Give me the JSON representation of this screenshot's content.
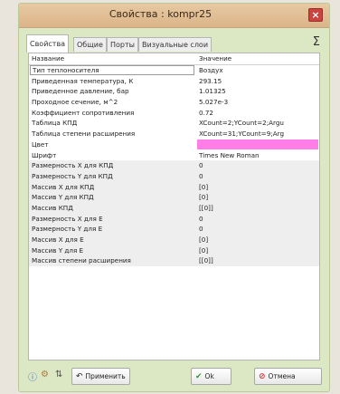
{
  "window": {
    "title": "Свойства : kompr25",
    "close_label": "×"
  },
  "tabs": [
    {
      "label": "Свойства",
      "active": true
    },
    {
      "label": "Общие",
      "active": false
    },
    {
      "label": "Порты",
      "active": false
    },
    {
      "label": "Визуальные слои",
      "active": false
    }
  ],
  "sigma_label": "Σ",
  "grid": {
    "headers": {
      "name": "Название",
      "value": "Значение"
    },
    "rows": [
      {
        "name": "Тип теплоносителя",
        "value": "Воздух"
      },
      {
        "name": "Приведенная температура, К",
        "value": "293.15"
      },
      {
        "name": "Приведенное давление, бар",
        "value": "1.01325"
      },
      {
        "name": "Проходное сечение, м^2",
        "value": "5.027e-3"
      },
      {
        "name": "Коэффициент сопротивления",
        "value": "0.72"
      },
      {
        "name": "Таблица КПД",
        "value": "XCount=2;YCount=2;Argu"
      },
      {
        "name": "Таблица степени расширения",
        "value": "XCount=31;YCount=9;Arg"
      },
      {
        "name": "Цвет",
        "value": ""
      },
      {
        "name": "Шрифт",
        "value": "Times New Roman"
      },
      {
        "name": "Размерность X для КПД",
        "value": "0"
      },
      {
        "name": "Размерность Y для КПД",
        "value": "0"
      },
      {
        "name": "Массив X для КПД",
        "value": "[0]"
      },
      {
        "name": "Массив Y для КПД",
        "value": "[0]"
      },
      {
        "name": "Массив КПД",
        "value": "[[0]]"
      },
      {
        "name": "Размерность X для Е",
        "value": "0"
      },
      {
        "name": "Размерность Y для Е",
        "value": "0"
      },
      {
        "name": "Массив X для Е",
        "value": "[0]"
      },
      {
        "name": "Массив Y для Е",
        "value": "[0]"
      },
      {
        "name": "Массив степени расширения",
        "value": "[[0]]"
      }
    ],
    "color_value_hex": "#ff7ee8"
  },
  "footer": {
    "icons": [
      "help-icon",
      "settings-icon",
      "sort-icon"
    ],
    "apply_label": "Применить",
    "ok_label": "Ok",
    "cancel_label": "Отмена"
  }
}
